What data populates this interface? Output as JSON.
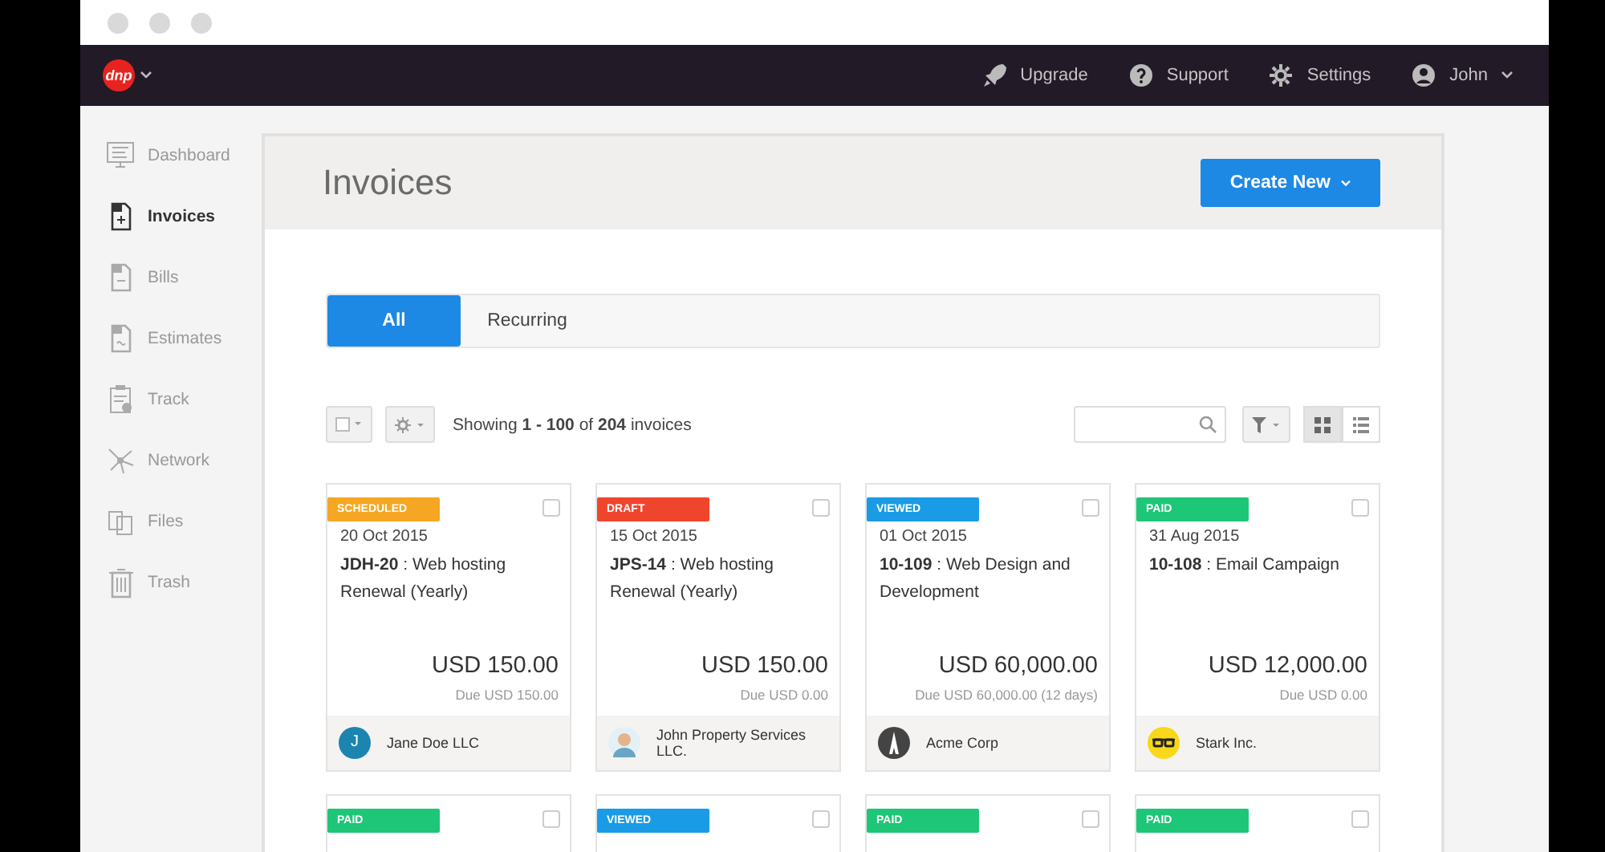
{
  "navbar": {
    "logo": "dnp",
    "items": [
      {
        "kind": "rocket",
        "label": "Upgrade"
      },
      {
        "kind": "help",
        "label": "Support"
      },
      {
        "kind": "gear",
        "label": "Settings"
      },
      {
        "kind": "user",
        "label": "John"
      }
    ]
  },
  "sidebar": {
    "items": [
      {
        "kind": "monitor",
        "label": "Dashboard",
        "selected": false
      },
      {
        "kind": "plus-doc",
        "label": "Invoices",
        "selected": true
      },
      {
        "kind": "minus-doc",
        "label": "Bills",
        "selected": false
      },
      {
        "kind": "tilde-doc",
        "label": "Estimates",
        "selected": false
      },
      {
        "kind": "clipboard",
        "label": "Track",
        "selected": false
      },
      {
        "kind": "network",
        "label": "Network",
        "selected": false
      },
      {
        "kind": "files",
        "label": "Files",
        "selected": false
      },
      {
        "kind": "trash",
        "label": "Trash",
        "selected": false
      }
    ]
  },
  "header": {
    "title": "Invoices",
    "button": "Create New"
  },
  "tabs": [
    {
      "label": "All",
      "selected": true
    },
    {
      "label": "Recurring",
      "selected": false
    }
  ],
  "toolbar": {
    "summary": "Showing **1 - 100** of **204** invoices",
    "view_buttons": [
      {
        "kind": "grid",
        "selected": true
      },
      {
        "kind": "list",
        "selected": false
      }
    ]
  },
  "cards": [
    {
      "status": "SCHEDULED",
      "color": "#f5a623",
      "checked": false,
      "date": "20 Oct 2015",
      "number": "JDH-20",
      "title": " : Web hosting Renewal (Yearly)",
      "amount": "USD 150.00",
      "due": "Due USD 150.00",
      "client": "Jane Doe LLC",
      "avatar": {
        "kind": "initial",
        "text": "J"
      }
    },
    {
      "status": "DRAFT",
      "color": "#f0452d",
      "checked": false,
      "date": "15 Oct 2015",
      "number": "JPS-14",
      "title": " : Web hosting Renewal (Yearly)",
      "amount": "USD 150.00",
      "due": "Due USD 0.00",
      "client": "John Property Services LLC.",
      "avatar": {
        "kind": "person"
      }
    },
    {
      "status": "VIEWED",
      "color": "#1a9be6",
      "checked": false,
      "date": "01 Oct 2015",
      "number": "10-109",
      "title": " : Web Design and Development",
      "amount": "USD 60,000.00",
      "due": "Due USD 60,000.00 (12 days)",
      "client": "Acme Corp",
      "avatar": {
        "kind": "tower"
      }
    },
    {
      "status": "PAID",
      "color": "#1ec677",
      "checked": false,
      "date": "31 Aug 2015",
      "number": "10-108",
      "title": " : Email Campaign",
      "amount": "USD 12,000.00",
      "due": "Due USD 0.00",
      "client": "Stark Inc.",
      "avatar": {
        "kind": "glasses"
      }
    },
    {
      "status": "PAID",
      "color": "#1ec677",
      "checked": false
    },
    {
      "status": "VIEWED",
      "color": "#1a9be6",
      "checked": false
    },
    {
      "status": "PAID",
      "color": "#1ec677",
      "checked": false
    },
    {
      "status": "PAID",
      "color": "#1ec677",
      "checked": false
    }
  ]
}
